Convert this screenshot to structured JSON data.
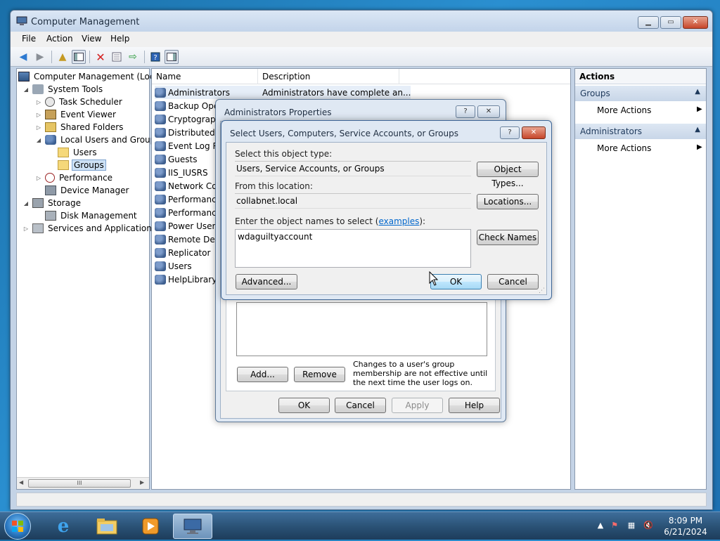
{
  "window": {
    "title": "Computer Management",
    "menu": [
      "File",
      "Action",
      "View",
      "Help"
    ]
  },
  "tree": {
    "root": "Computer Management (Local",
    "system_tools": "System Tools",
    "task_scheduler": "Task Scheduler",
    "event_viewer": "Event Viewer",
    "shared_folders": "Shared Folders",
    "local_users_groups": "Local Users and Groups",
    "users": "Users",
    "groups": "Groups",
    "performance": "Performance",
    "device_manager": "Device Manager",
    "storage": "Storage",
    "disk_management": "Disk Management",
    "services_apps": "Services and Applications",
    "scroll_grip": "III"
  },
  "list": {
    "col_name": "Name",
    "col_description": "Description",
    "rows": [
      {
        "name": "Administrators",
        "description": "Administrators have complete an..."
      },
      {
        "name": "Backup Oper"
      },
      {
        "name": "Cryptograph"
      },
      {
        "name": "Distributed C"
      },
      {
        "name": "Event Log Re"
      },
      {
        "name": "Guests"
      },
      {
        "name": "IIS_IUSRS"
      },
      {
        "name": "Network Cor"
      },
      {
        "name": "Performance"
      },
      {
        "name": "Performance"
      },
      {
        "name": "Power Users"
      },
      {
        "name": "Remote Desk"
      },
      {
        "name": "Replicator"
      },
      {
        "name": "Users"
      },
      {
        "name": "HelpLibraryU"
      }
    ]
  },
  "actions": {
    "title": "Actions",
    "section1": "Groups",
    "section1_item": "More Actions",
    "section2": "Administrators",
    "section2_item": "More Actions"
  },
  "admin_props": {
    "title": "Administrators Properties",
    "note": "Changes to a user's group membership are not effective until the next time the user logs on.",
    "add": "Add...",
    "remove": "Remove",
    "ok": "OK",
    "cancel": "Cancel",
    "apply": "Apply",
    "help": "Help"
  },
  "select_dialog": {
    "title": "Select Users, Computers, Service Accounts, or Groups",
    "object_type_label": "Select this object type:",
    "object_type_value": "Users, Service Accounts, or Groups",
    "object_types_button": "Object Types...",
    "location_label": "From this location:",
    "location_value": "collabnet.local",
    "locations_button": "Locations...",
    "names_label_prefix": "Enter the object names to select (",
    "names_label_link": "examples",
    "names_label_suffix": "):",
    "names_value": "wdaguiltyaccount",
    "check_names_button": "Check Names",
    "advanced_button": "Advanced...",
    "ok_button": "OK",
    "cancel_button": "Cancel"
  },
  "taskbar": {
    "time": "8:09 PM",
    "date": "6/21/2024"
  }
}
